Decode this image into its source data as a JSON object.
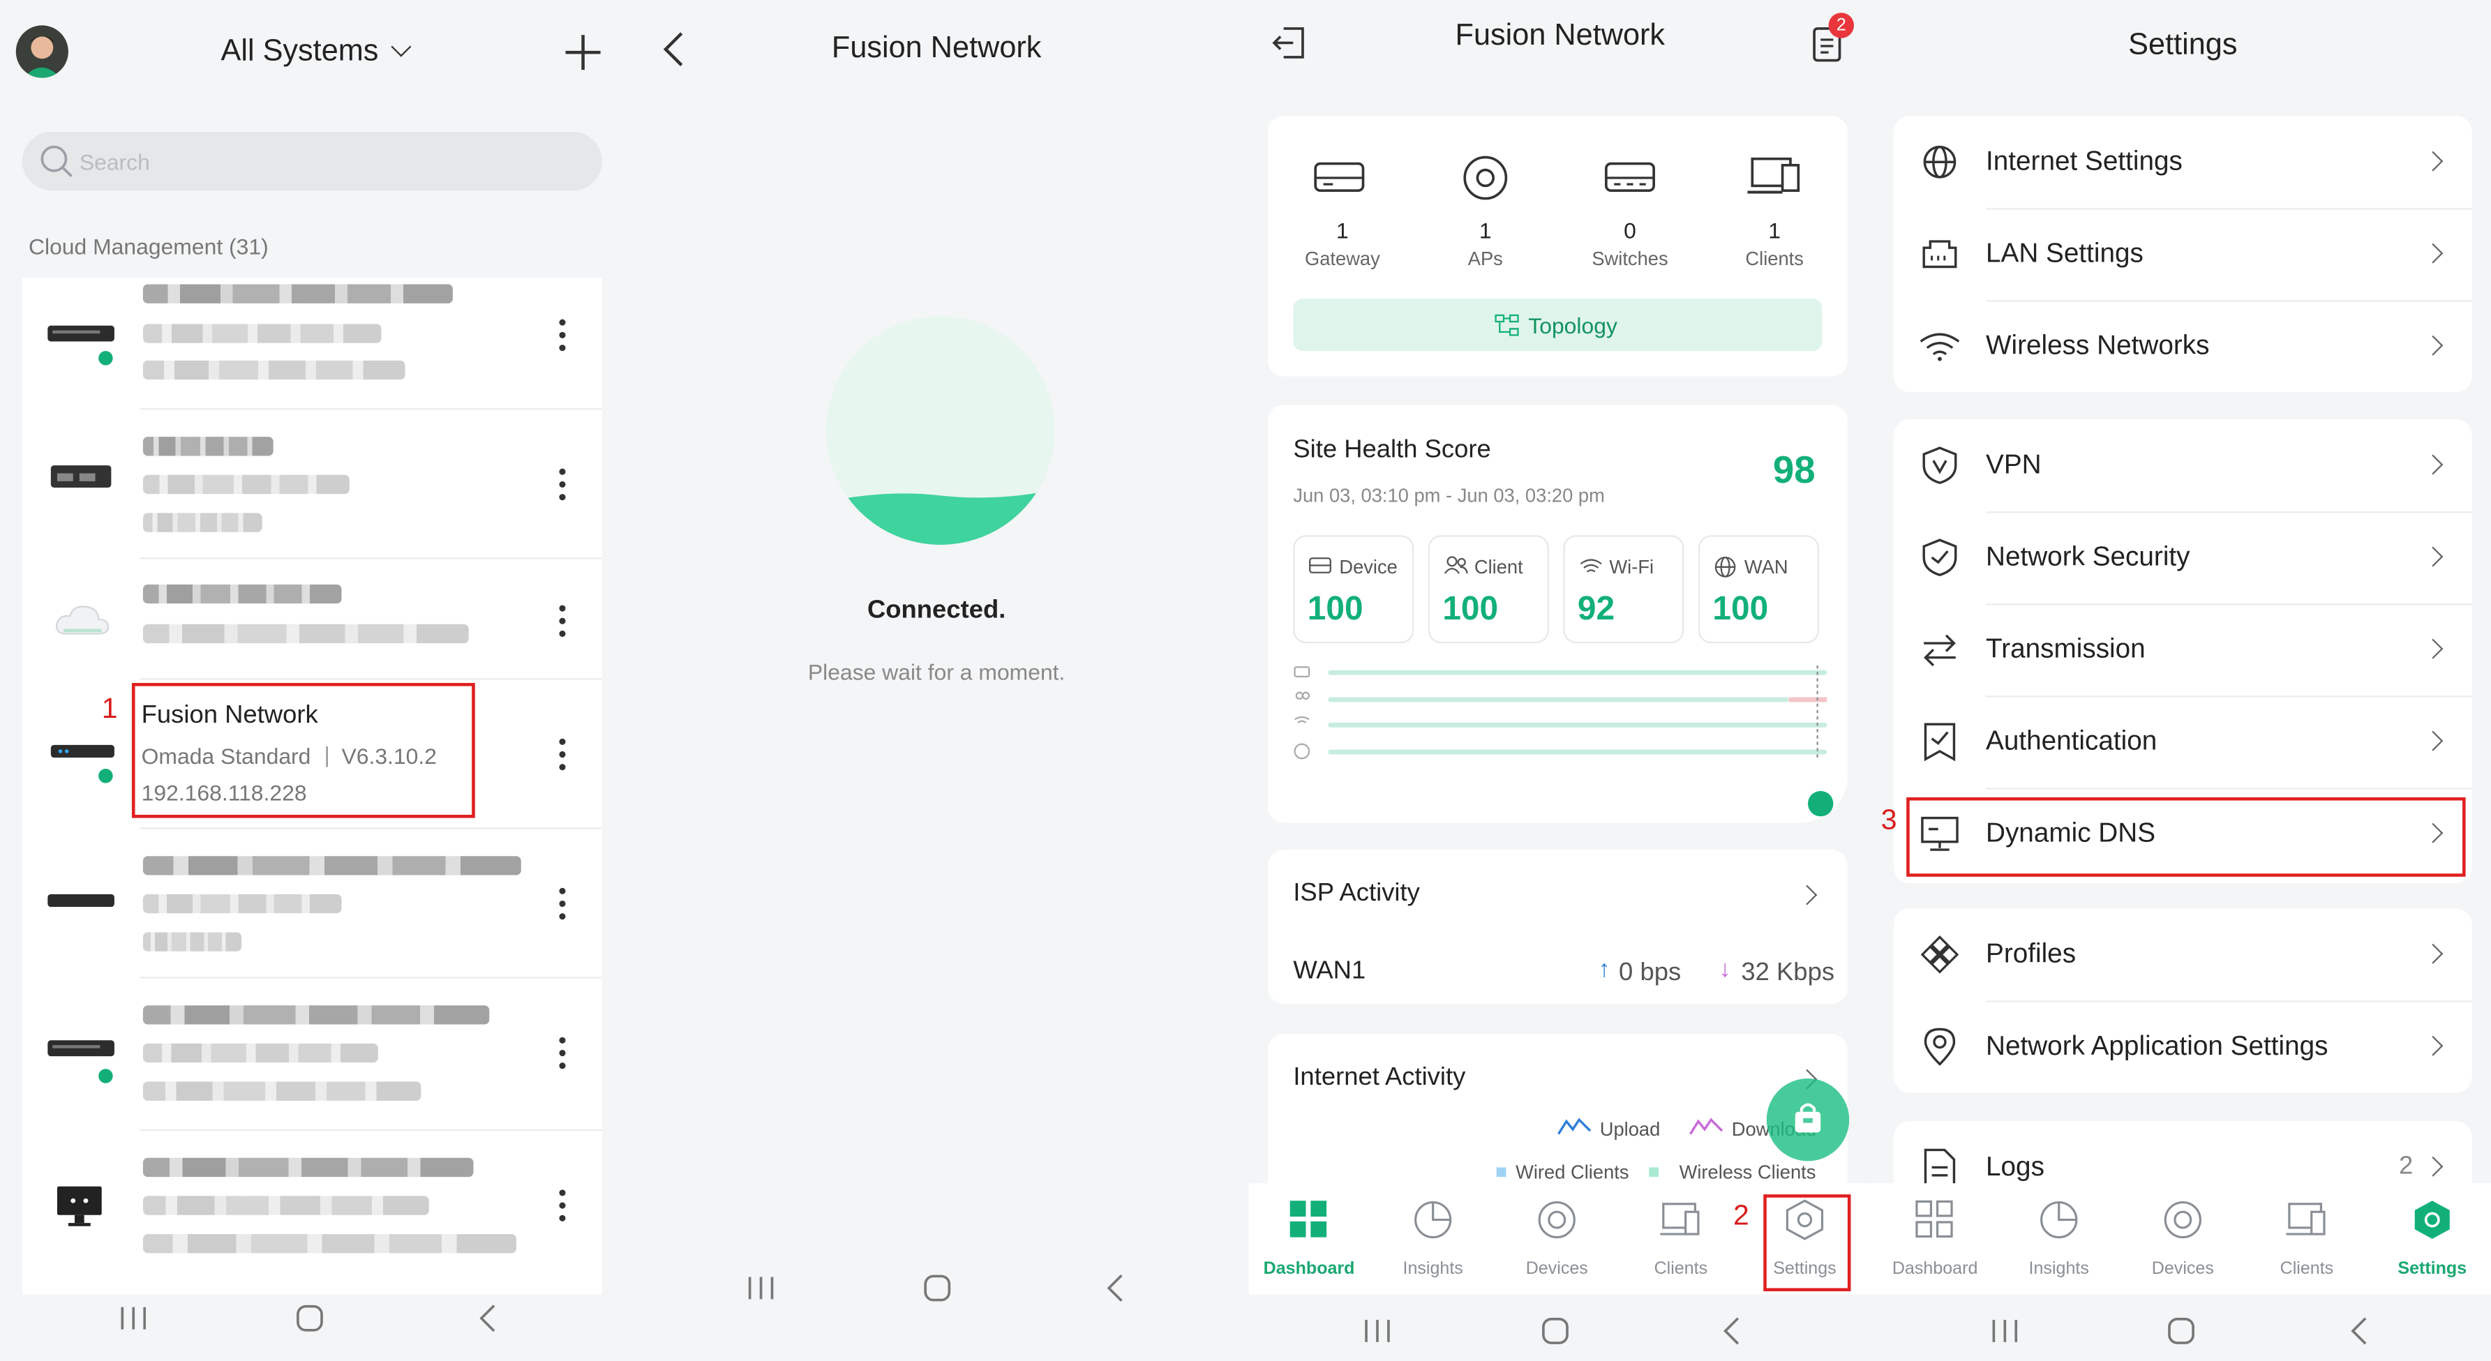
{
  "panel1": {
    "title": "All Systems",
    "search_placeholder": "Search",
    "section": "Cloud Management (31)",
    "selected": {
      "name": "Fusion Network",
      "controller": "Omada Standard",
      "separator": "|",
      "version": "V6.3.10.2",
      "ip": "192.168.118.228"
    },
    "step": "1"
  },
  "panel2": {
    "title": "Fusion Network",
    "status": "Connected.",
    "sub": "Please wait for a moment."
  },
  "panel3": {
    "title": "Fusion Network",
    "badge": "2",
    "stats": [
      {
        "value": "1",
        "label": "Gateway"
      },
      {
        "value": "1",
        "label": "APs"
      },
      {
        "value": "0",
        "label": "Switches"
      },
      {
        "value": "1",
        "label": "Clients"
      }
    ],
    "topology": "Topology",
    "health": {
      "title": "Site Health Score",
      "score": "98",
      "range": "Jun 03, 03:10 pm - Jun 03, 03:20 pm",
      "items": [
        {
          "label": "Device",
          "value": "100"
        },
        {
          "label": "Client",
          "value": "100"
        },
        {
          "label": "Wi-Fi",
          "value": "92"
        },
        {
          "label": "WAN",
          "value": "100"
        }
      ]
    },
    "isp": {
      "title": "ISP Activity",
      "wan": "WAN1",
      "up": "0 bps",
      "down": "32 Kbps"
    },
    "internet": {
      "title": "Internet Activity",
      "upload": "Upload",
      "download": "Download",
      "wired": "Wired Clients",
      "wireless": "Wireless Clients"
    },
    "tabs": [
      "Dashboard",
      "Insights",
      "Devices",
      "Clients",
      "Settings"
    ],
    "step": "2"
  },
  "panel4": {
    "title": "Settings",
    "group1": [
      "Internet Settings",
      "LAN Settings",
      "Wireless Networks"
    ],
    "group2": [
      "VPN",
      "Network Security",
      "Transmission",
      "Authentication",
      "Dynamic DNS"
    ],
    "group3": [
      "Profiles",
      "Network Application Settings"
    ],
    "logs": "Logs",
    "logs_count": "2",
    "tabs": [
      "Dashboard",
      "Insights",
      "Devices",
      "Clients",
      "Settings"
    ],
    "step": "3"
  },
  "colors": {
    "accent": "#12b078",
    "red": "#e02020",
    "badge": "#e8363c"
  }
}
